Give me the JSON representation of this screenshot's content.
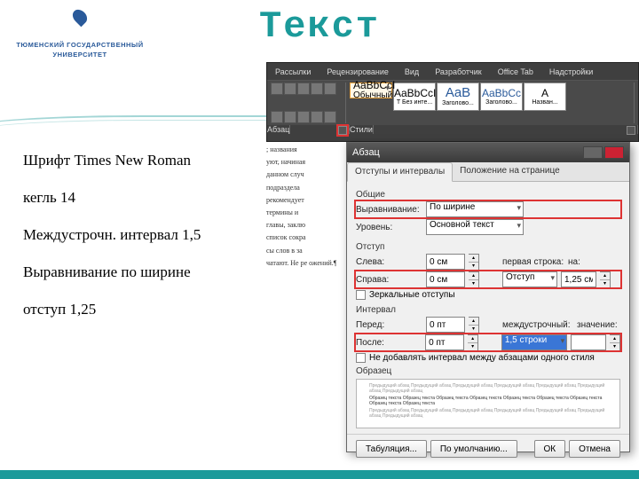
{
  "title": "Текст",
  "logo": {
    "line1": "ТЮМЕНСКИЙ ГОСУДАРСТВЕННЫЙ",
    "line2": "УНИВЕРСИТЕТ"
  },
  "reqs": [
    "Шрифт Times New Roman",
    "кегль 14",
    "Междустрочн. интервал 1,5",
    " Выравнивание по ширине",
    "отступ 1,25"
  ],
  "ribbon": {
    "tabs": [
      "Рассылки",
      "Рецензирование",
      "Вид",
      "Разработчик",
      "Office Tab",
      "Надстройки"
    ],
    "groups": [
      "Абзац",
      "Стили"
    ],
    "styles": [
      {
        "sample": "AaBbCcI",
        "name": "Обычный"
      },
      {
        "sample": "AaBbCcI",
        "name": "Т Без инте..."
      },
      {
        "sample": "AaB",
        "name": "Заголово..."
      },
      {
        "sample": "AaBbCc",
        "name": "Заголово..."
      },
      {
        "sample": "A",
        "name": "Назван..."
      }
    ]
  },
  "bgdoc": [
    "; названия",
    "уют, начиная",
    "данном случ",
    "подраздела",
    "рекомендует",
    "термины и",
    "главы, заклю",
    "список сокра",
    "сы слов в за",
    "чатают. Не ре\nожений.¶"
  ],
  "dialog": {
    "title": "Абзац",
    "tabs": [
      "Отступы и интервалы",
      "Положение на странице"
    ],
    "general_label": "Общие",
    "alignment_label": "Выравнивание:",
    "alignment_value": "По ширине",
    "outline_label": "Уровень:",
    "outline_value": "Основной текст",
    "indent_label": "Отступ",
    "left_label": "Слева:",
    "left_value": "0 см",
    "right_label": "Справа:",
    "right_value": "0 см",
    "first_line_label": "первая строка:",
    "special_value": "Отступ",
    "by_label": "на:",
    "by_value": "1,25 см",
    "mirror_label": "Зеркальные отступы",
    "spacing_label": "Интервал",
    "before_label": "Перед:",
    "before_value": "0 пт",
    "after_label": "После:",
    "after_value": "0 пт",
    "line_spacing_label": "междустрочный:",
    "line_spacing_value": "1,5 строки",
    "at_label": "значение:",
    "at_value": "",
    "no_space_label": "Не добавлять интервал между абзацами одного стиля",
    "preview_label": "Образец",
    "preview_text1": "Предыдущий абзац Предыдущий абзац Предыдущий абзац Предыдущий абзац Предыдущий абзац Предыдущий абзац Предыдущий абзац",
    "preview_text2": "Образец текста Образец текста Образец текста Образец текста Образец текста Образец текста Образец текста Образец текста Образец текста",
    "btn_tabs": "Табуляция...",
    "btn_default": "По умолчанию...",
    "btn_ok": "ОК",
    "btn_cancel": "Отмена"
  }
}
